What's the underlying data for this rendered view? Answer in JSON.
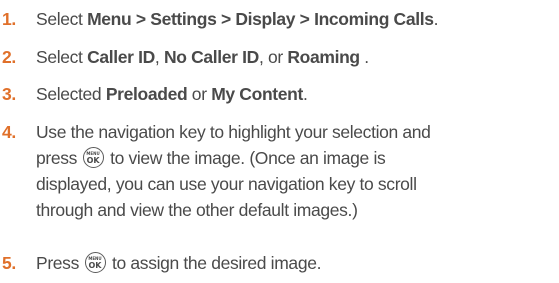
{
  "steps": [
    {
      "number": "1.",
      "parts": [
        "Select ",
        "Menu > Settings > Display > Incoming Calls",
        "."
      ]
    },
    {
      "number": "2.",
      "parts": [
        "Select ",
        "Caller ID",
        ", ",
        "No Caller ID",
        ", or ",
        "Roaming",
        " ."
      ]
    },
    {
      "number": "3.",
      "parts": [
        "Selected ",
        "Preloaded",
        " or ",
        "My Content",
        "."
      ]
    },
    {
      "number": "4.",
      "lines": [
        "Use the navigation key to highlight your selection and",
        " to view the image. (Once an image is",
        "displayed, you can use your navigation key to scroll",
        "through and view the other default images.)"
      ],
      "press_label": "press"
    },
    {
      "number": "5.",
      "press_label": "Press",
      "text": " to assign the desired image."
    }
  ],
  "menu_ok_key": {
    "icon": "menu-ok-key-icon",
    "top_label": "MENU",
    "bottom_label": "OK"
  }
}
